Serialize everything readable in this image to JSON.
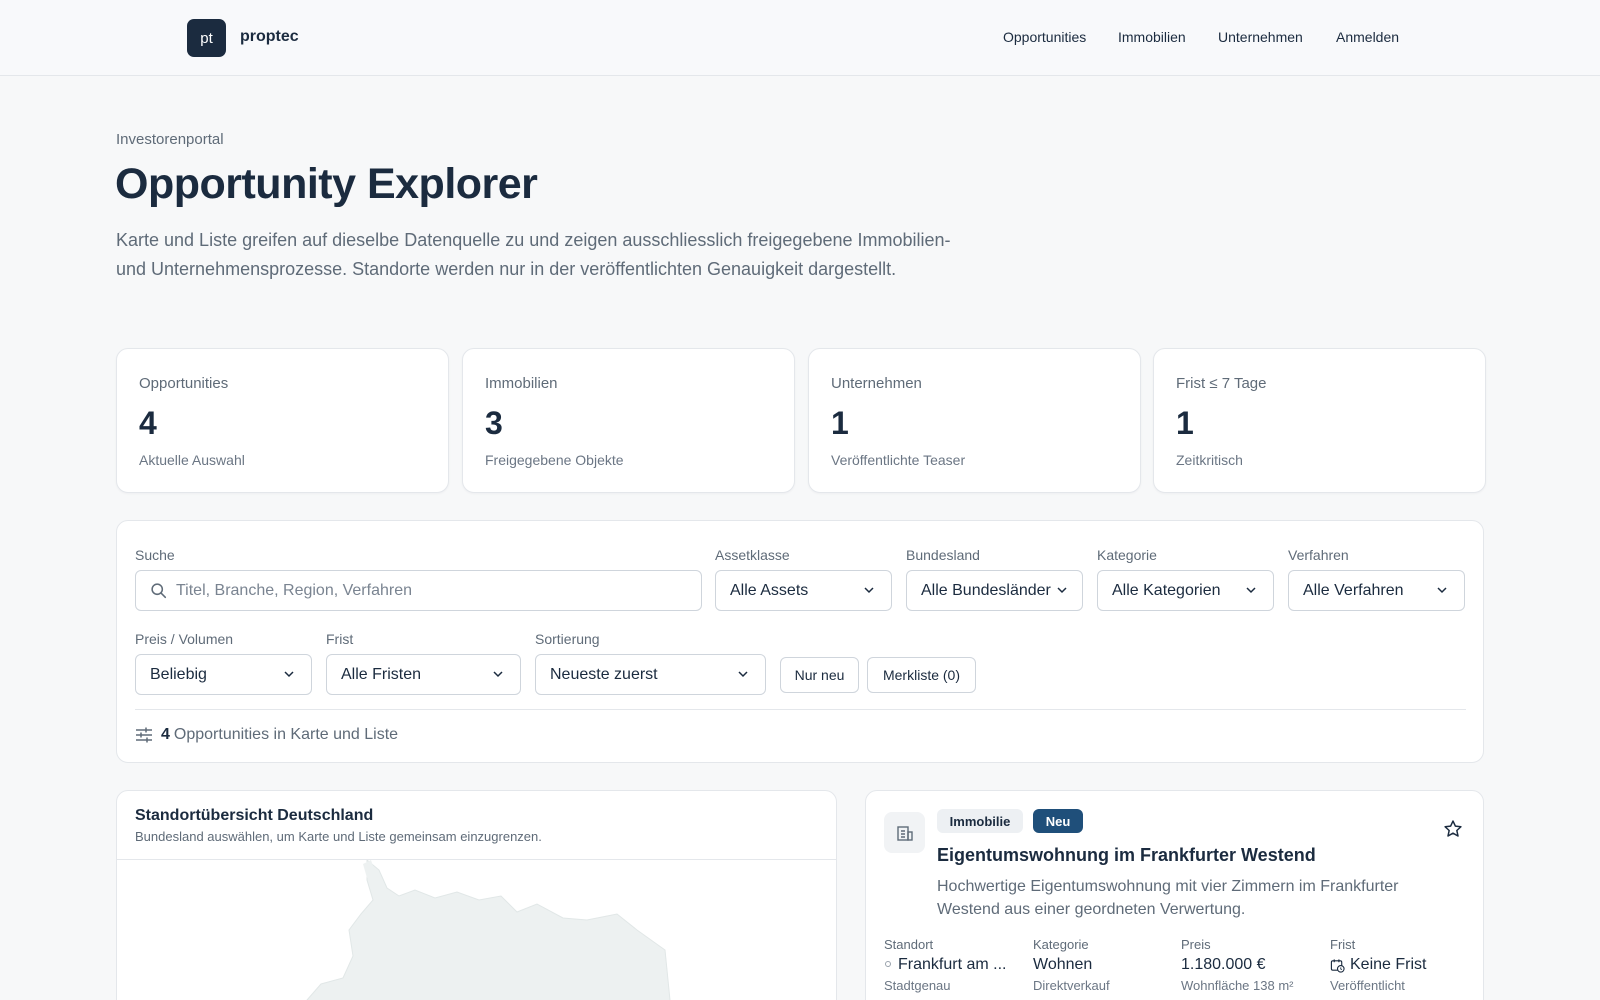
{
  "header": {
    "logo": "pt",
    "brand": "proptec",
    "nav": [
      "Opportunities",
      "Immobilien",
      "Unternehmen",
      "Anmelden"
    ]
  },
  "hero": {
    "eyebrow": "Investorenportal",
    "title": "Opportunity Explorer",
    "lead": "Karte und Liste greifen auf dieselbe Datenquelle zu und zeigen ausschliesslich freigegebene Immobilien- und Unternehmensprozesse. Standorte werden nur in der veröffentlichten Genauigkeit dargestellt."
  },
  "stats": [
    {
      "label": "Opportunities",
      "value": "4",
      "sub": "Aktuelle Auswahl"
    },
    {
      "label": "Immobilien",
      "value": "3",
      "sub": "Freigegebene Objekte"
    },
    {
      "label": "Unternehmen",
      "value": "1",
      "sub": "Veröffentlichte Teaser"
    },
    {
      "label": "Frist ≤ 7 Tage",
      "value": "1",
      "sub": "Zeitkritisch"
    }
  ],
  "filters": {
    "search_label": "Suche",
    "search_placeholder": "Titel, Branche, Region, Verfahren",
    "asset_label": "Assetklasse",
    "asset_value": "Alle Assets",
    "state_label": "Bundesland",
    "state_value": "Alle Bundesländer",
    "category_label": "Kategorie",
    "category_value": "Alle Kategorien",
    "procedure_label": "Verfahren",
    "procedure_value": "Alle Verfahren",
    "price_label": "Preis / Volumen",
    "price_value": "Beliebig",
    "deadline_label": "Frist",
    "deadline_value": "Alle Fristen",
    "sort_label": "Sortierung",
    "sort_value": "Neueste zuerst",
    "only_new": "Nur neu",
    "watchlist": "Merkliste (0)",
    "result_count": "4",
    "result_text": "Opportunities in Karte und Liste"
  },
  "map": {
    "title": "Standortübersicht Deutschland",
    "subtitle": "Bundesland auswählen, um Karte und Liste gemeinsam einzugrenzen."
  },
  "opportunity": {
    "type_badge": "Immobilie",
    "new_badge": "Neu",
    "title": "Eigentumswohnung im Frankfurter Westend",
    "description": "Hochwertige Eigentumswohnung mit vier Zimmern im Frankfurter Westend aus einer geordneten Verwertung.",
    "meta": [
      {
        "label": "Standort",
        "value": "Frankfurt am ...",
        "sub": "Stadtgenau"
      },
      {
        "label": "Kategorie",
        "value": "Wohnen",
        "sub": "Direktverkauf"
      },
      {
        "label": "Preis",
        "value": "1.180.000 €",
        "sub": "Wohnfläche 138 m²"
      },
      {
        "label": "Frist",
        "value": "Keine Frist",
        "sub": "Veröffentlicht"
      }
    ]
  },
  "colors": {
    "primary": "#1b2b3f",
    "accent": "#1f4f7a",
    "muted": "#5f6b78",
    "border": "#e4e7eb",
    "map_land": "#edf1f1"
  }
}
